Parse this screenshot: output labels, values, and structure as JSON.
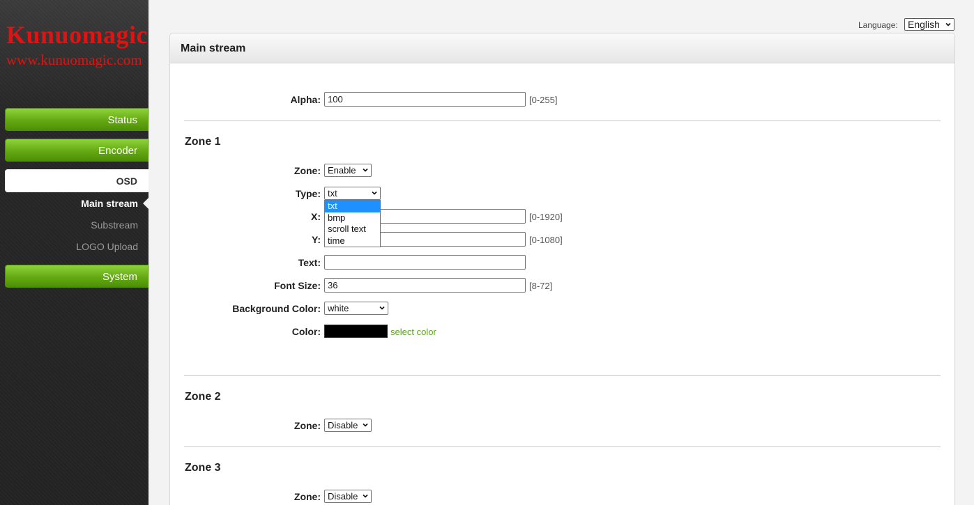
{
  "brand": {
    "name": "Kunuomagic",
    "url": "www.kunuomagic.com"
  },
  "nav": {
    "status": "Status",
    "encoder": "Encoder",
    "osd": "OSD",
    "system": "System",
    "osd_sub": [
      "Main stream",
      "Substream",
      "LOGO Upload"
    ]
  },
  "language": {
    "label": "Language:",
    "value": "English"
  },
  "panel": {
    "title": "Main stream"
  },
  "alpha": {
    "label": "Alpha:",
    "value": "100",
    "range": "[0-255]"
  },
  "zone1": {
    "title": "Zone 1",
    "zone_label": "Zone:",
    "zone_value": "Enable",
    "type_label": "Type:",
    "type_value": "txt",
    "type_options": [
      "txt",
      "bmp",
      "scroll text",
      "time"
    ],
    "x_label": "X:",
    "x_range": "[0-1920]",
    "y_label": "Y:",
    "y_range": "[0-1080]",
    "text_label": "Text:",
    "text_value": "",
    "font_label": "Font Size:",
    "font_value": "36",
    "font_range": "[8-72]",
    "bg_label": "Background Color:",
    "bg_value": "white",
    "color_label": "Color:",
    "color_value": "#000000",
    "color_link": "select color"
  },
  "zone2": {
    "title": "Zone 2",
    "zone_label": "Zone:",
    "zone_value": "Disable"
  },
  "zone3": {
    "title": "Zone 3",
    "zone_label": "Zone:",
    "zone_value": "Disable"
  }
}
